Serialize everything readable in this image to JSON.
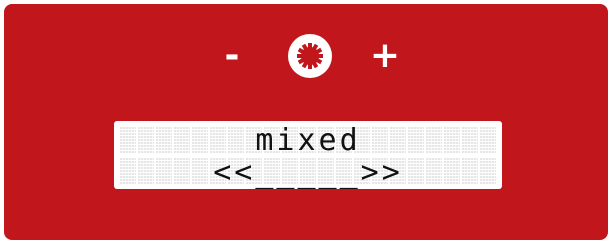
{
  "controls": {
    "minus_label": "-",
    "plus_label": "+",
    "knob_icon": "gear-icon"
  },
  "display": {
    "line1": "mixed",
    "line2": "<<_____>>"
  },
  "colors": {
    "panel": "#c1171c",
    "lcd_background": "#ffffff",
    "text": "#111111"
  }
}
